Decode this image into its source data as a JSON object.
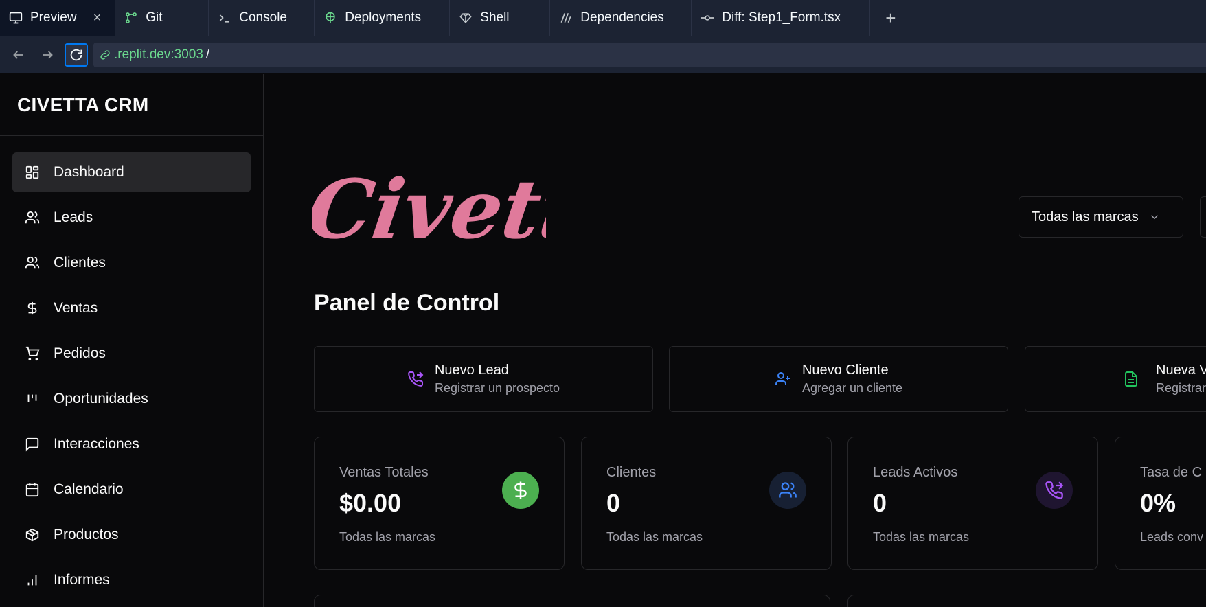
{
  "tabs": [
    {
      "label": "Preview",
      "icon": "monitor-icon",
      "active": true,
      "closable": true
    },
    {
      "label": "Git",
      "icon": "git-icon"
    },
    {
      "label": "Console",
      "icon": "terminal-icon"
    },
    {
      "label": "Deployments",
      "icon": "deployments-icon"
    },
    {
      "label": "Shell",
      "icon": "shell-icon"
    },
    {
      "label": "Dependencies",
      "icon": "dependencies-icon"
    },
    {
      "label": "Diff: Step1_Form.tsx",
      "icon": "commit-icon"
    }
  ],
  "close_glyph": "×",
  "add_tab_glyph": "+",
  "url": {
    "host": ".replit.dev:3003",
    "path": "/"
  },
  "sidebar": {
    "brand": "CIVETTA CRM",
    "items": [
      {
        "label": "Dashboard",
        "icon": "dashboard-icon",
        "active": true
      },
      {
        "label": "Leads",
        "icon": "users-icon"
      },
      {
        "label": "Clientes",
        "icon": "users-icon"
      },
      {
        "label": "Ventas",
        "icon": "dollar-icon"
      },
      {
        "label": "Pedidos",
        "icon": "cart-icon"
      },
      {
        "label": "Oportunidades",
        "icon": "kanban-icon"
      },
      {
        "label": "Interacciones",
        "icon": "message-icon"
      },
      {
        "label": "Calendario",
        "icon": "calendar-icon"
      },
      {
        "label": "Productos",
        "icon": "package-icon"
      },
      {
        "label": "Informes",
        "icon": "bar-chart-icon"
      }
    ]
  },
  "main": {
    "logo_text": "Civetta",
    "brand_filter": "Todas las marcas",
    "page_title": "Panel de Control",
    "quick_actions": [
      {
        "title": "Nuevo Lead",
        "subtitle": "Registrar un prospecto",
        "icon": "phone-forward-icon",
        "color": "#a855f7"
      },
      {
        "title": "Nuevo Cliente",
        "subtitle": "Agregar un cliente",
        "icon": "user-plus-icon",
        "color": "#3b82f6"
      },
      {
        "title": "Nueva V",
        "subtitle": "Registrar",
        "icon": "file-text-icon",
        "color": "#22c55e"
      }
    ],
    "stats": [
      {
        "title": "Ventas Totales",
        "value": "$0.00",
        "subtitle": "Todas las marcas",
        "icon": "dollar-icon",
        "bg": "#4caf50",
        "fg": "#ffffff"
      },
      {
        "title": "Clientes",
        "value": "0",
        "subtitle": "Todas las marcas",
        "icon": "users-icon",
        "bg": "#172033",
        "fg": "#3b82f6"
      },
      {
        "title": "Leads Activos",
        "value": "0",
        "subtitle": "Todas las marcas",
        "icon": "phone-forward-icon",
        "bg": "#1f1530",
        "fg": "#a855f7"
      },
      {
        "title": "Tasa de C",
        "value": "0%",
        "subtitle": "Leads conv",
        "icon": "",
        "bg": "",
        "fg": ""
      }
    ]
  },
  "colors": {
    "accent": "#0079f2",
    "logo": "#e07a9b",
    "url_host": "#6bd88e"
  }
}
